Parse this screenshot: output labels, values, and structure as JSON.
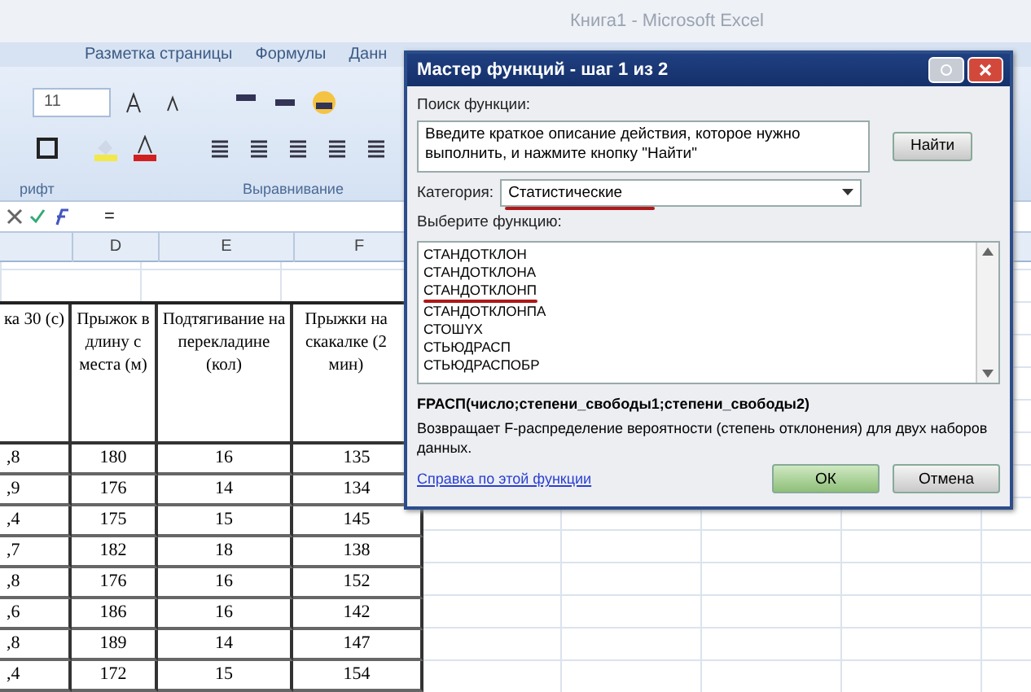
{
  "window": {
    "title": "Книга1 - Microsoft Excel"
  },
  "ribbon": {
    "tabs": [
      {
        "label": "Разметка страницы",
        "selected": false
      },
      {
        "label": "Формулы",
        "selected": false
      },
      {
        "label": "Данн",
        "selected": false
      }
    ],
    "font_size": "11",
    "groups": [
      "рифт",
      "Выравнивание"
    ]
  },
  "formula_bar": {
    "value": "="
  },
  "sheet": {
    "column_headers": [
      "D",
      "E",
      "F"
    ],
    "header": [
      "ка 30 (с)",
      "Прыжок в длину с места (м)",
      "Подтягивание на перекладине (кол)",
      "Прыжки на скакалке (2 мин)"
    ],
    "rows": [
      [
        ",8",
        "180",
        "16",
        "135"
      ],
      [
        ",9",
        "176",
        "14",
        "134"
      ],
      [
        ",4",
        "175",
        "15",
        "145"
      ],
      [
        ",7",
        "182",
        "18",
        "138"
      ],
      [
        ",8",
        "176",
        "16",
        "152"
      ],
      [
        ",6",
        "186",
        "16",
        "142"
      ],
      [
        ",8",
        "189",
        "14",
        "147"
      ],
      [
        ",4",
        "172",
        "15",
        "154"
      ]
    ]
  },
  "dialog": {
    "title": "Мастер функций - шаг 1 из 2",
    "search_label": "Поиск функции:",
    "search_value": "Введите краткое описание действия, которое нужно выполнить, и нажмите кнопку \"Найти\"",
    "find_button": "Найти",
    "category_label": "Категория:",
    "category": {
      "value": "Статистические",
      "marked": true
    },
    "list_label": "Выберите функцию:",
    "functions": [
      {
        "name": "СТАНДОТКЛОН",
        "marked": false
      },
      {
        "name": "СТАНДОТКЛОНА",
        "marked": false
      },
      {
        "name": "СТАНДОТКЛОНП",
        "marked": true
      },
      {
        "name": "СТАНДОТКЛОНПА",
        "marked": false
      },
      {
        "name": "СТОШYX",
        "marked": false
      },
      {
        "name": "СТЬЮДРАСП",
        "marked": false
      },
      {
        "name": "СТЬЮДРАСПОБР",
        "marked": false
      }
    ],
    "signature": "FРАСП(число;степени_свободы1;степени_свободы2)",
    "description": "Возвращает F-распределение вероятности (степень отклонения) для двух наборов данных.",
    "help_link": "Справка по этой функции",
    "ok_button": "ОК",
    "cancel_button": "Отмена"
  }
}
